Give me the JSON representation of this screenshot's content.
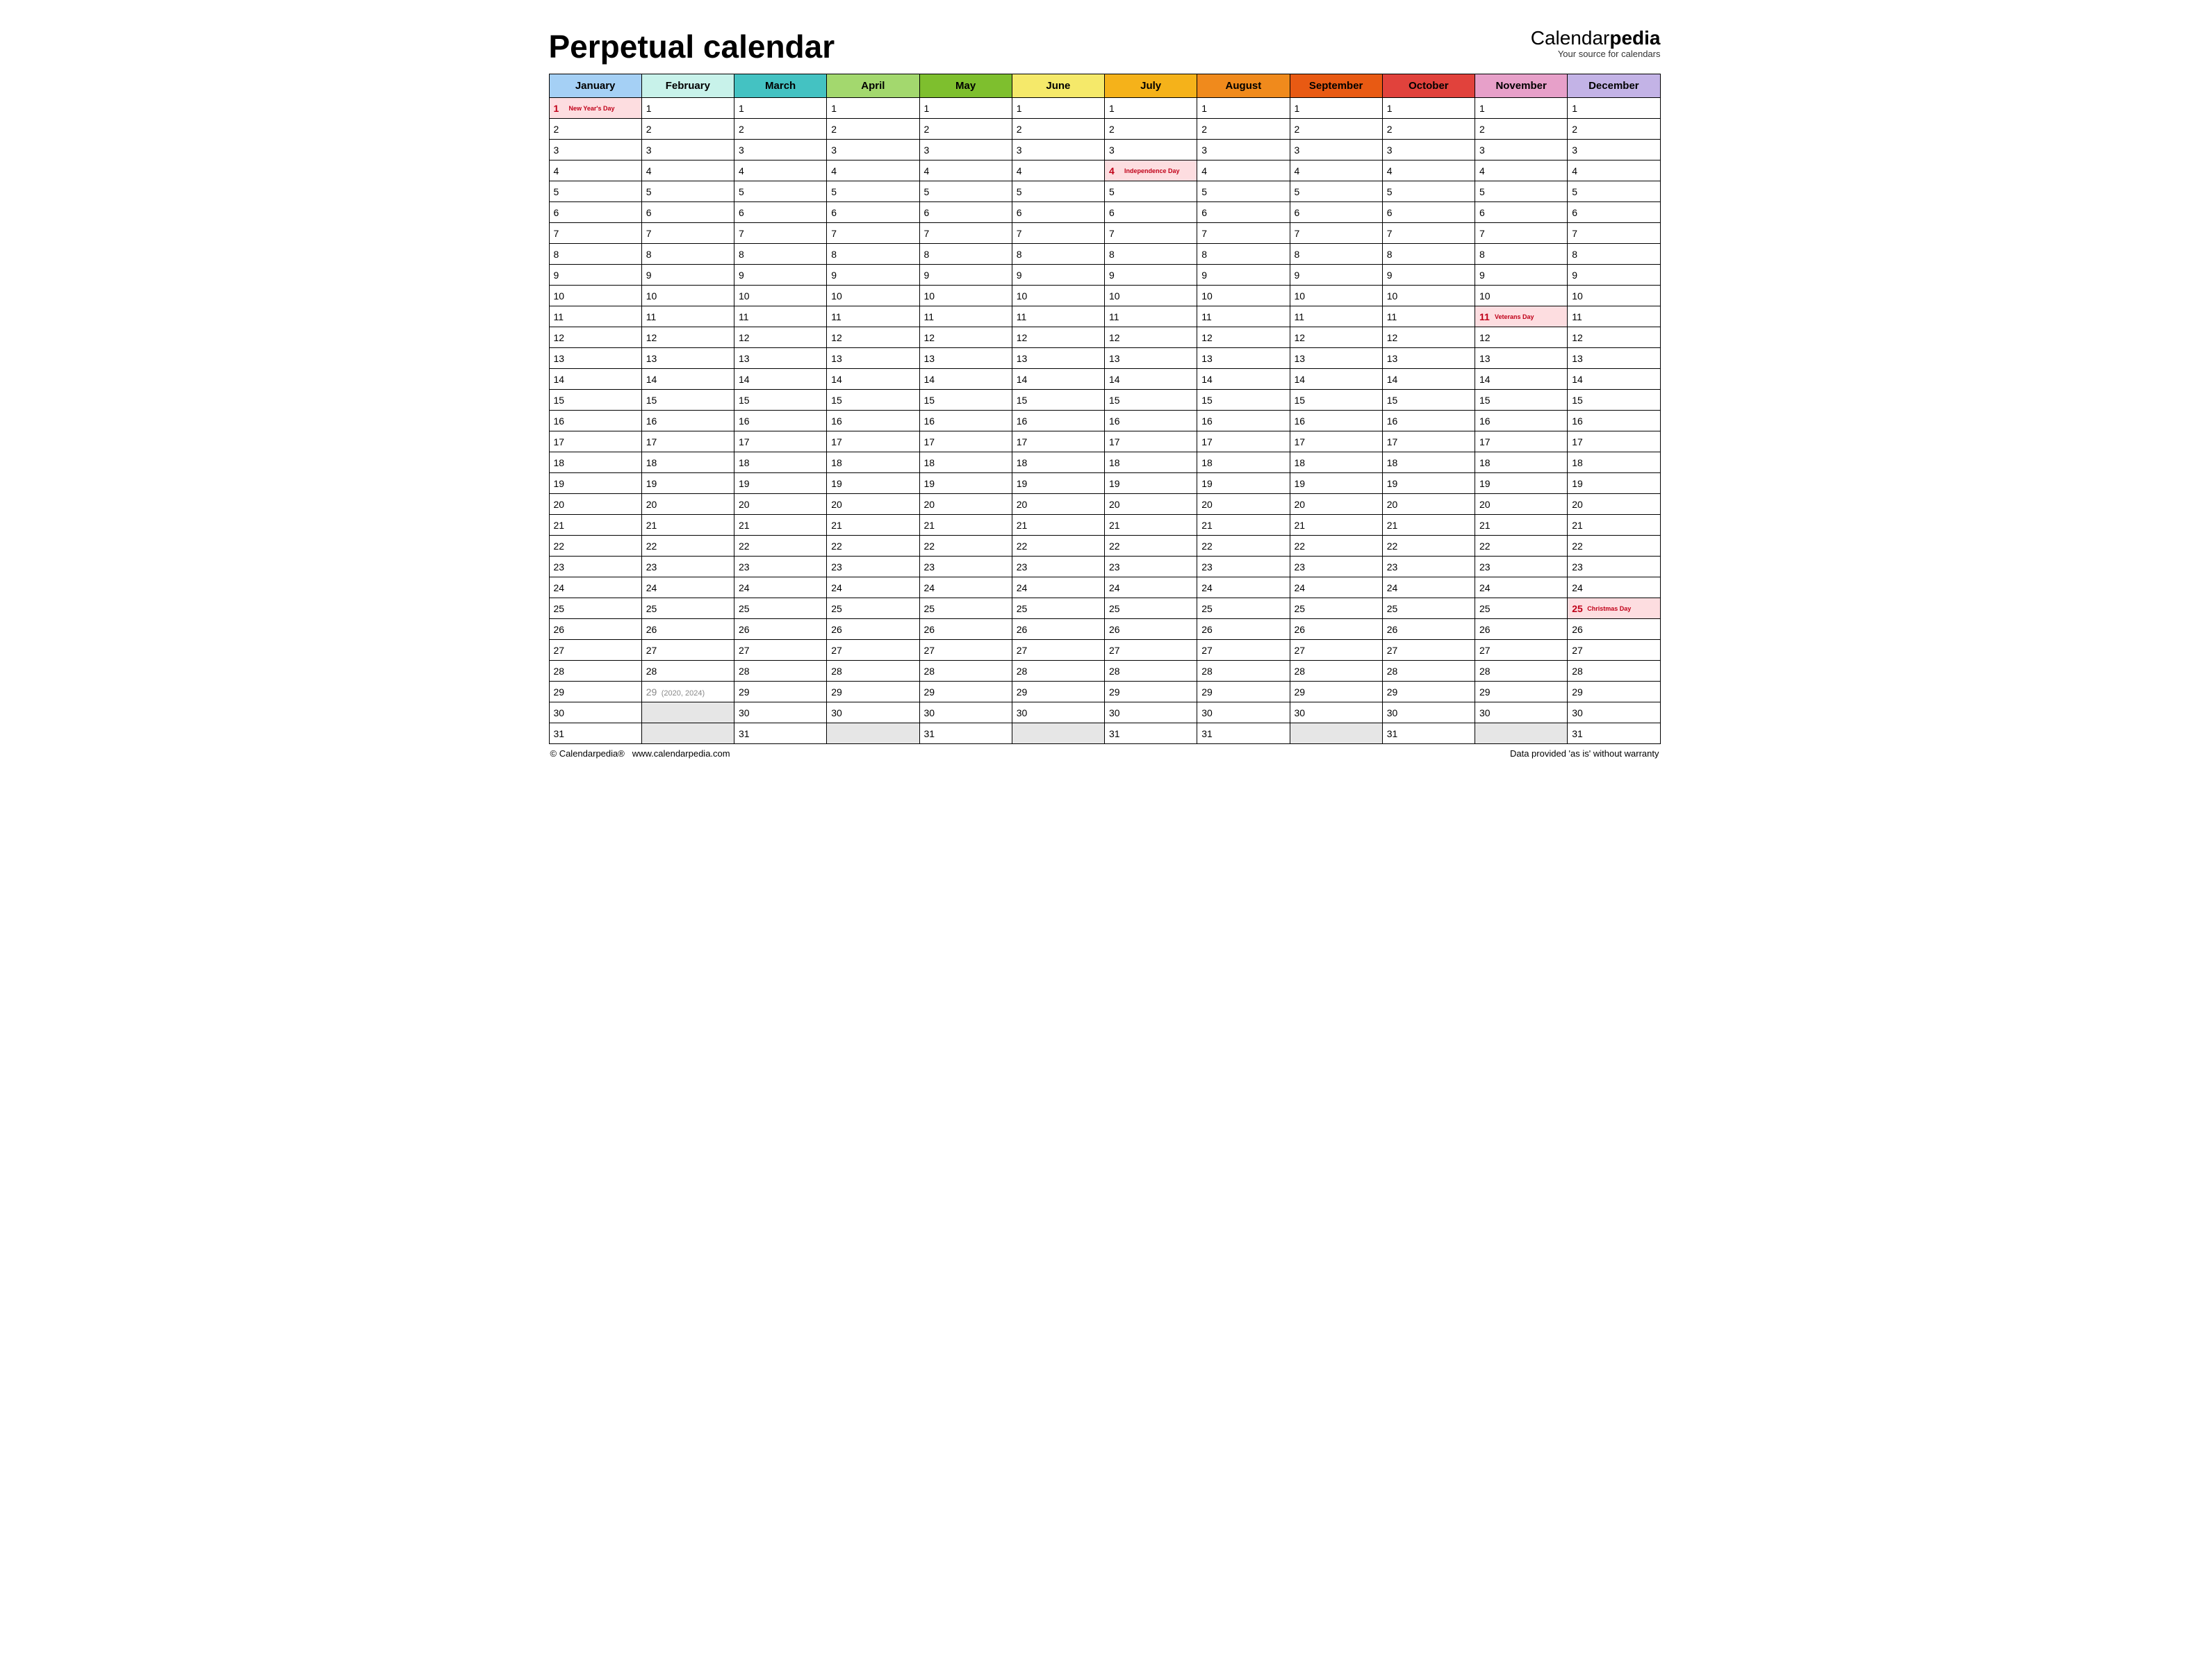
{
  "title": "Perpetual calendar",
  "brand": {
    "pre": "Calendar",
    "bold": "pedia",
    "tagline": "Your source for calendars"
  },
  "months": [
    {
      "name": "January",
      "days": 31,
      "color": "#a5d0f5"
    },
    {
      "name": "February",
      "days": 29,
      "color": "#c8f2ea"
    },
    {
      "name": "March",
      "days": 31,
      "color": "#44c2c2"
    },
    {
      "name": "April",
      "days": 30,
      "color": "#a3d86e"
    },
    {
      "name": "May",
      "days": 31,
      "color": "#7ebf2e"
    },
    {
      "name": "June",
      "days": 30,
      "color": "#f5e96a"
    },
    {
      "name": "July",
      "days": 31,
      "color": "#f5b21a"
    },
    {
      "name": "August",
      "days": 31,
      "color": "#f08a1c"
    },
    {
      "name": "September",
      "days": 30,
      "color": "#e85a13"
    },
    {
      "name": "October",
      "days": 31,
      "color": "#e1423c"
    },
    {
      "name": "November",
      "days": 30,
      "color": "#e7a0c9"
    },
    {
      "name": "December",
      "days": 31,
      "color": "#c3b3e6"
    }
  ],
  "maxDays": 31,
  "holidays": [
    {
      "month": 0,
      "day": 1,
      "name": "New Year's Day"
    },
    {
      "month": 6,
      "day": 4,
      "name": "Independence Day"
    },
    {
      "month": 10,
      "day": 11,
      "name": "Veterans Day"
    },
    {
      "month": 11,
      "day": 25,
      "name": "Christmas Day"
    }
  ],
  "leap": {
    "month": 1,
    "day": 29,
    "note": "(2020, 2024)"
  },
  "footer": {
    "left_copyright": "© Calendarpedia®",
    "left_url": "www.calendarpedia.com",
    "right": "Data provided 'as is' without warranty"
  }
}
